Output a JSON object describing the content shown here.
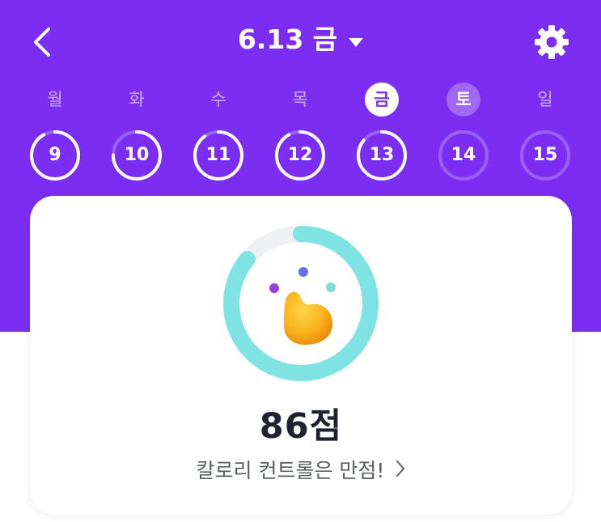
{
  "header": {
    "date_label": "6.13 금",
    "icons": {
      "back": "chevron-left-icon",
      "dropdown": "caret-down-icon",
      "settings": "gear-icon"
    }
  },
  "week": [
    {
      "dow": "월",
      "day": "9",
      "state": "past",
      "progress": 0.92
    },
    {
      "dow": "화",
      "day": "10",
      "state": "past",
      "progress": 0.75
    },
    {
      "dow": "수",
      "day": "11",
      "state": "past",
      "progress": 0.9
    },
    {
      "dow": "목",
      "day": "12",
      "state": "past",
      "progress": 0.92
    },
    {
      "dow": "금",
      "day": "13",
      "state": "today",
      "progress": 0.86
    },
    {
      "dow": "토",
      "day": "14",
      "state": "future",
      "progress": 0
    },
    {
      "dow": "일",
      "day": "15",
      "state": "future",
      "progress": 0
    }
  ],
  "score_card": {
    "score_label": "86점",
    "score_progress": 0.86,
    "message": "칼로리 컨트롤은 만점!",
    "icons": {
      "mascot": "blob-mascot-icon",
      "more": "chevron-right-icon"
    }
  },
  "colors": {
    "primary": "#7B2EF2",
    "ring": "#7FE3E4",
    "ring_track": "#EEF0F4",
    "week_track": "rgba(255,255,255,0.25)"
  }
}
